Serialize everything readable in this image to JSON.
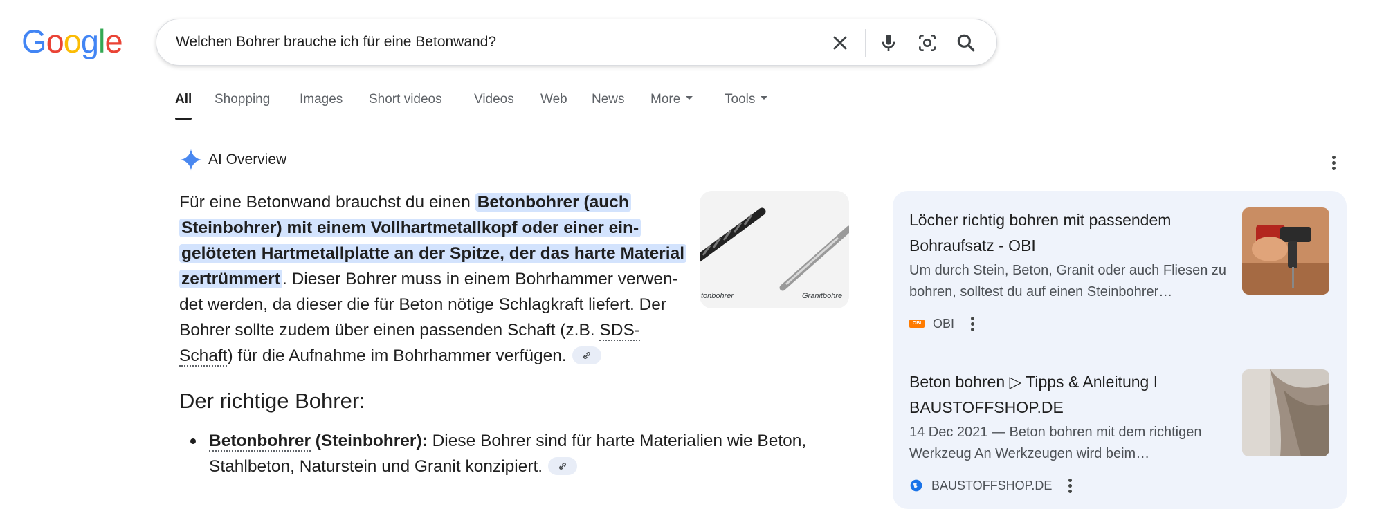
{
  "logo": {
    "text": "Google",
    "letters": [
      {
        "ch": "G",
        "color": "#4285F4"
      },
      {
        "ch": "o",
        "color": "#EA4335"
      },
      {
        "ch": "o",
        "color": "#FBBC05"
      },
      {
        "ch": "g",
        "color": "#4285F4"
      },
      {
        "ch": "l",
        "color": "#34A853"
      },
      {
        "ch": "e",
        "color": "#EA4335"
      }
    ]
  },
  "search": {
    "query": "Welchen Bohrer brauche ich für eine Betonwand?"
  },
  "tabs": [
    {
      "label": "All",
      "active": true
    },
    {
      "label": "Shopping"
    },
    {
      "label": "Images"
    },
    {
      "label": "Short videos"
    },
    {
      "label": "Videos"
    },
    {
      "label": "Web"
    },
    {
      "label": "News"
    },
    {
      "label": "More"
    },
    {
      "label": "Tools"
    }
  ],
  "ai_overview": {
    "title": "AI Overview",
    "p1_intro": "Für eine Betonwand brauchst du einen ",
    "p1_highlight": "Betonbohrer (auch Steinbohrer) mit einem Vollhartmetallkopf oder einer ein­gelöteten Hartmetallplatte an der Spitze, der das harte Material zertrümmert",
    "p1_rest": ". Dieser Bohrer muss in einem Bohrhammer verwen­det werden, da dieser die für Beton nötige Schlagkraft liefert. Der Bohrer sollte zudem über einen passenden Schaft (z.B. ",
    "p1_sds": "SDS-Schaft",
    "p1_end": ") für die Aufnahme im Bohrhammer verfügen.",
    "image_captions": [
      "tonbohrer",
      "Granitbohre"
    ],
    "section_heading": "Der richtige Bohrer:",
    "bullet_term": "Betonbohrer",
    "bullet_term_rest": " (Steinbohrer):",
    "bullet_text": " Diese Bohrer sind für harte Materialien wie Beton, Stahlbeton, Naturstein und Granit konzipiert."
  },
  "sources": [
    {
      "title": "Löcher richtig bohren mit passendem Bohraufsatz - OBI",
      "snippet": "Um durch Stein, Beton, Granit oder auch Fliesen zu bohren, solltest du auf einen Steinbohrer…",
      "site": "OBI",
      "favicon_text": "OBI"
    },
    {
      "title": "Beton bohren ▷ Tipps & Anleitung I BAUSTOFFSHOP.DE",
      "snippet": "14 Dec 2021 — Beton bohren mit dem richtigen Werkzeug An Werkzeugen wird beim…",
      "site": "BAUSTOFFSHOP.DE"
    }
  ],
  "colors": {
    "highlight": "#d3e3fd",
    "accent_blue": "#1a73e8",
    "obi_orange": "#ff7b00"
  }
}
